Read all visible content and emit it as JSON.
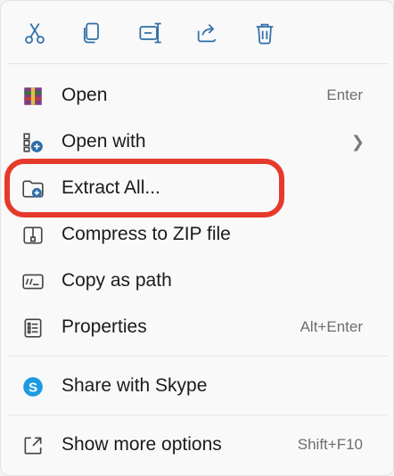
{
  "toolbar": {
    "buttons": [
      {
        "icon": "cut-icon",
        "name": "cut-button"
      },
      {
        "icon": "copy-icon",
        "name": "copy-button"
      },
      {
        "icon": "rename-icon",
        "name": "rename-button"
      },
      {
        "icon": "share-icon",
        "name": "share-button"
      },
      {
        "icon": "delete-icon",
        "name": "delete-button"
      }
    ]
  },
  "menu": {
    "items": [
      {
        "label": "Open",
        "accelerator": "Enter",
        "icon": "winrar-icon"
      },
      {
        "label": "Open with",
        "accelerator": "",
        "icon": "open-with-icon",
        "submenu": true
      },
      {
        "label": "Extract All...",
        "accelerator": "",
        "icon": "extract-folder-icon"
      },
      {
        "label": "Compress to ZIP file",
        "accelerator": "",
        "icon": "zip-icon"
      },
      {
        "label": "Copy as path",
        "accelerator": "",
        "icon": "copy-path-icon"
      },
      {
        "label": "Properties",
        "accelerator": "Alt+Enter",
        "icon": "properties-icon"
      },
      {
        "label": "Share with Skype",
        "accelerator": "",
        "icon": "skype-icon"
      },
      {
        "label": "Show more options",
        "accelerator": "Shift+F10",
        "icon": "show-more-icon"
      }
    ]
  },
  "colors": {
    "accent": "#2b6cb0",
    "highlight": "#e53a2b",
    "text": "#1b1b1b",
    "muted": "#6e6e6e"
  }
}
